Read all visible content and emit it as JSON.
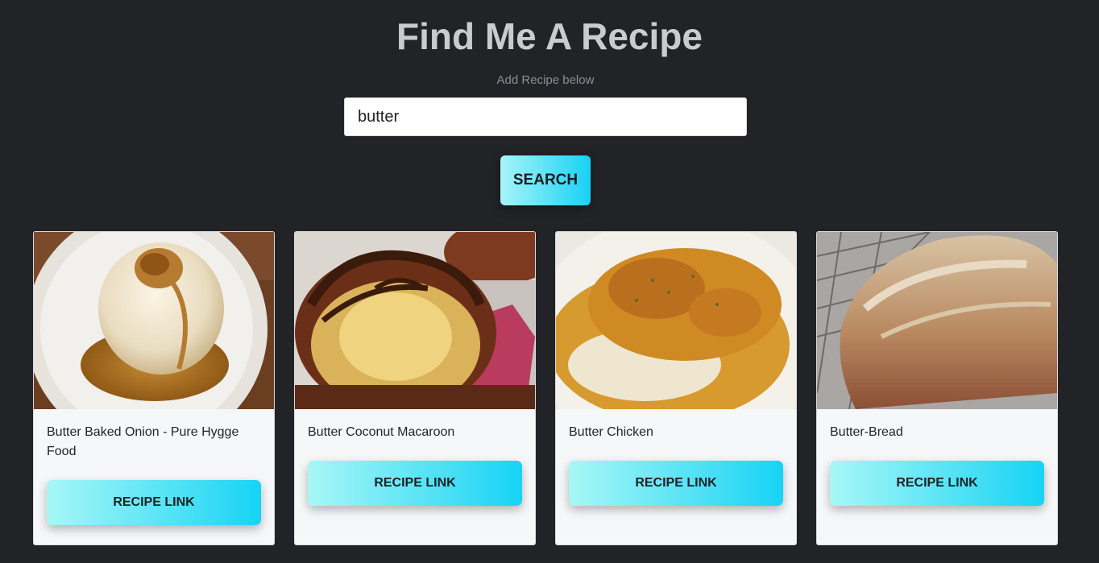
{
  "header": {
    "title": "Find Me A Recipe",
    "subtitle": "Add Recipe below"
  },
  "search": {
    "value": "butter",
    "button_label": "SEARCH"
  },
  "recipes": [
    {
      "title": "Butter Baked Onion - Pure Hygge Food",
      "link_label": "RECIPE LINK",
      "image": "baked-onion-photo"
    },
    {
      "title": "Butter Coconut Macaroon",
      "link_label": "RECIPE LINK",
      "image": "coconut-macaroon-photo"
    },
    {
      "title": "Butter Chicken",
      "link_label": "RECIPE LINK",
      "image": "butter-chicken-photo"
    },
    {
      "title": "Butter-Bread",
      "link_label": "RECIPE LINK",
      "image": "bread-loaf-photo"
    }
  ]
}
